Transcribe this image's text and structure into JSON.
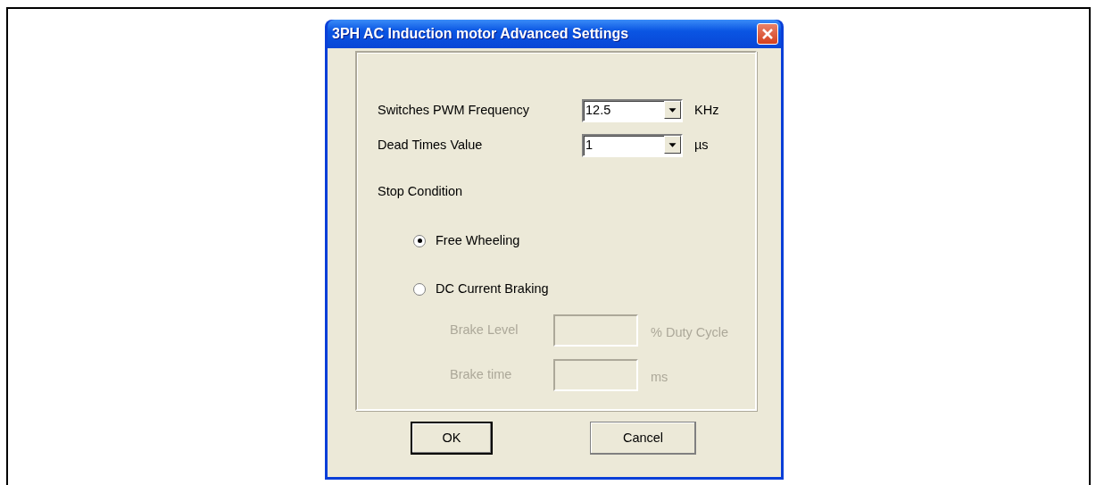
{
  "window": {
    "title": "3PH AC Induction motor Advanced Settings"
  },
  "settings": [
    {
      "label": "Switches PWM Frequency",
      "value": "12.5",
      "unit": "KHz"
    },
    {
      "label": "Dead Times Value",
      "value": "1",
      "unit": "µs"
    }
  ],
  "stop_condition": {
    "label": "Stop Condition",
    "options": [
      {
        "label": "Free Wheeling",
        "selected": true
      },
      {
        "label": "DC Current Braking",
        "selected": false
      }
    ],
    "brake_fields": [
      {
        "label": "Brake Level",
        "unit": "% Duty Cycle",
        "disabled": true
      },
      {
        "label": "Brake time",
        "unit": "ms",
        "disabled": true
      }
    ]
  },
  "buttons": [
    {
      "label": "OK",
      "default": true
    },
    {
      "label": "Cancel",
      "default": false
    }
  ]
}
